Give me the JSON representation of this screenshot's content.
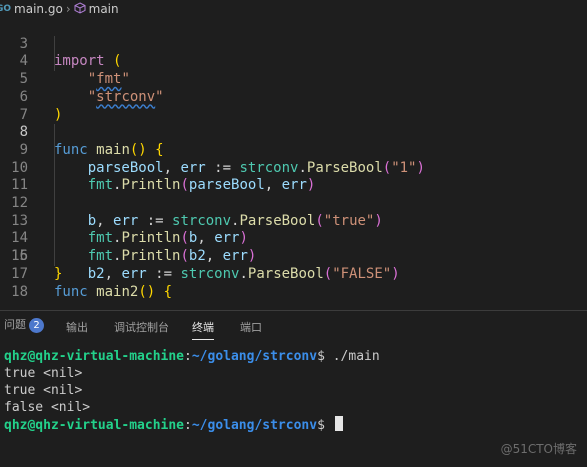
{
  "breadcrumb": {
    "file": "main.go",
    "symbol": "main"
  },
  "editor": {
    "lines": [
      {
        "num": "3",
        "text": "import ("
      },
      {
        "num": "4",
        "text": "    \"fmt\""
      },
      {
        "num": "5",
        "text": "    \"strconv\""
      },
      {
        "num": "6",
        "text": ")"
      },
      {
        "num": "7",
        "text": ""
      },
      {
        "num": "8",
        "text": "func main() {"
      },
      {
        "num": "9",
        "text": "    parseBool, err := strconv.ParseBool(\"1\")"
      },
      {
        "num": "10",
        "text": "    fmt.Println(parseBool, err)"
      },
      {
        "num": "11",
        "text": ""
      },
      {
        "num": "12",
        "text": "    b, err := strconv.ParseBool(\"true\")"
      },
      {
        "num": "13",
        "text": "    fmt.Println(b, err)"
      },
      {
        "num": "14",
        "text": ""
      },
      {
        "num": "15",
        "text": "    b2, err := strconv.ParseBool(\"FALSE\")"
      },
      {
        "num": "16",
        "text": "    fmt.Println(b2, err)"
      },
      {
        "num": "17",
        "text": "}"
      },
      {
        "num": "18",
        "text": "func main2() {"
      }
    ],
    "active_line": "8"
  },
  "panel": {
    "tabs": [
      {
        "label": "问题",
        "badge": "2"
      },
      {
        "label": "输出"
      },
      {
        "label": "调试控制台"
      },
      {
        "label": "终端",
        "active": true
      },
      {
        "label": "端口"
      }
    ]
  },
  "terminal": {
    "prompt_user": "qhz@qhz-virtual-machine",
    "prompt_path": "~/golang/strconv",
    "command": "./main",
    "output": [
      "true <nil>",
      "true <nil>",
      "false <nil>"
    ]
  },
  "watermark": "@51CTO博客",
  "colors": {
    "background": "#1e1e1e",
    "keyword": "#c586c0",
    "string": "#ce9178",
    "function": "#dcdcaa",
    "prompt_user": "#23d18b",
    "prompt_path": "#3b8eea",
    "badge": "#4d78cc"
  }
}
